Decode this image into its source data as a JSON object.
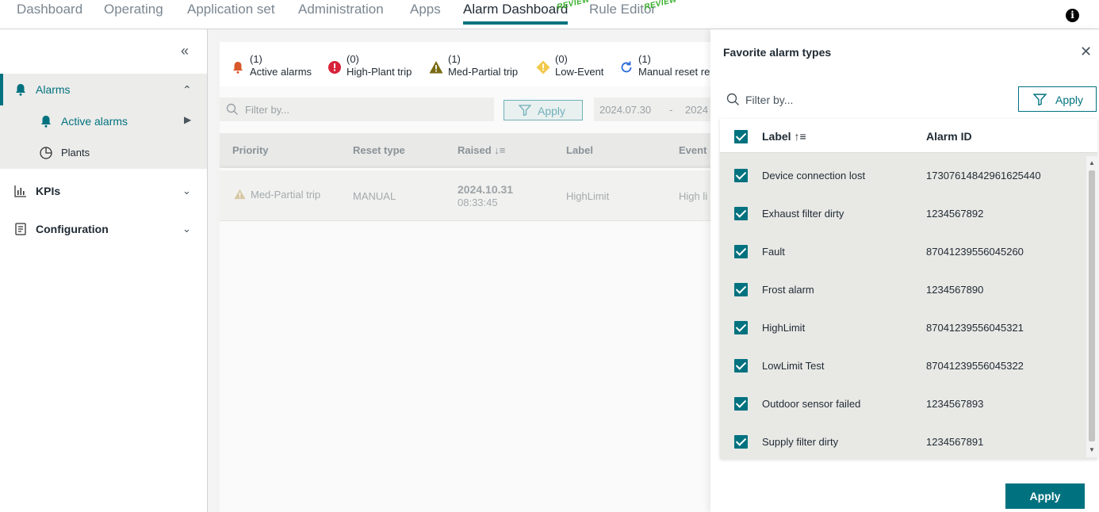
{
  "nav": {
    "tabs": [
      "Dashboard",
      "Operating",
      "Application set",
      "Administration",
      "Apps",
      "Alarm Dashboard",
      "Rule Editor"
    ],
    "preview_badge": "REVIEW",
    "info_glyph": "i",
    "active_tab": "Alarm Dashboard"
  },
  "sidebar": {
    "collapse_glyph": "«",
    "items": [
      {
        "label": "Alarms",
        "icon": "bell-icon",
        "expanded": true
      },
      {
        "label": "Active alarms",
        "icon": "bell-icon",
        "selected": true
      },
      {
        "label": "Plants",
        "icon": "pie-chart-icon"
      },
      {
        "label": "KPIs",
        "icon": "bar-chart-icon"
      },
      {
        "label": "Configuration",
        "icon": "config-icon"
      }
    ],
    "chevron_up": "︿",
    "chevron_down": "﹀",
    "play_glyph": "▶"
  },
  "summary": [
    {
      "count": "(1)",
      "label": "Active alarms",
      "icon": "bell-icon",
      "color": "#d9592b"
    },
    {
      "count": "(0)",
      "label": "High-Plant trip",
      "icon": "error-circle-icon",
      "color": "#d72339"
    },
    {
      "count": "(1)",
      "label": "Med-Partial trip",
      "icon": "warning-triangle-icon",
      "color": "#7a6a14"
    },
    {
      "count": "(0)",
      "label": "Low-Event",
      "icon": "warning-diamond-icon",
      "color": "#f2c94c"
    },
    {
      "count": "(1)",
      "label": "Manual reset re",
      "icon": "refresh-icon",
      "color": "#2a6ad8"
    }
  ],
  "filter": {
    "placeholder": "Filter by...",
    "apply_label": "Apply",
    "date_from": "2024.07.30",
    "date_sep": "-",
    "date_to": "2024"
  },
  "table": {
    "headers": [
      "Priority",
      "Reset type",
      "Raised ↓≡",
      "Label",
      "Event"
    ],
    "rows": [
      {
        "priority": "Med-Partial trip",
        "reset_type": "MANUAL",
        "raised_date": "2024.10.31",
        "raised_time": "08:33:45",
        "label": "HighLimit",
        "event": "High li"
      }
    ]
  },
  "panel": {
    "title": "Favorite alarm types",
    "close_glyph": "✕",
    "filter_placeholder": "Filter by...",
    "apply_outline_label": "Apply",
    "col_label": "Label ↑≡",
    "col_id": "Alarm ID",
    "rows": [
      {
        "label": "Device connection lost",
        "id": "17307614842961625440"
      },
      {
        "label": "Exhaust filter dirty",
        "id": "1234567892"
      },
      {
        "label": "Fault",
        "id": "87041239556045260"
      },
      {
        "label": "Frost alarm",
        "id": "1234567890"
      },
      {
        "label": "HighLimit",
        "id": "87041239556045321"
      },
      {
        "label": "LowLimit Test",
        "id": "87041239556045322"
      },
      {
        "label": "Outdoor sensor failed",
        "id": "1234567893"
      },
      {
        "label": "Supply filter dirty",
        "id": "1234567891"
      }
    ],
    "apply_solid_label": "Apply",
    "scroll_up": "▲",
    "scroll_down": "▼"
  }
}
